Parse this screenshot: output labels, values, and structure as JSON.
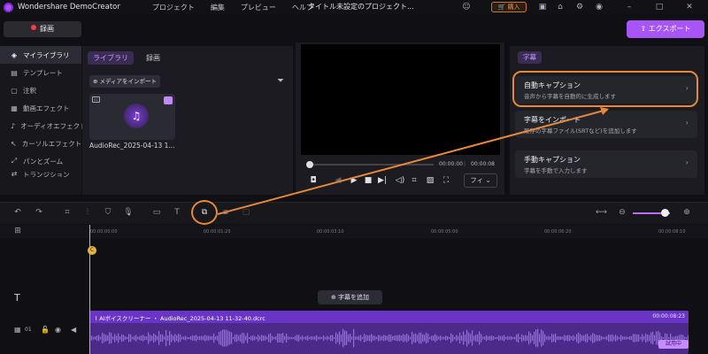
{
  "app": {
    "name": "Wondershare DemoCreator",
    "doc_title": "タイトル未設定のプロジェクト...",
    "menu": [
      "プロジェクト",
      "編集",
      "プレビュー",
      "ヘルプ"
    ],
    "buy_label": "購入"
  },
  "toolbar": {
    "record_label": "録画",
    "export_label": "エクスポート"
  },
  "sidebar": {
    "items": [
      {
        "label": "マイライブラリ",
        "icon": "layers-icon"
      },
      {
        "label": "テンプレート",
        "icon": "template-icon"
      },
      {
        "label": "注釈",
        "icon": "annotation-icon"
      },
      {
        "label": "動画エフェクト",
        "icon": "video-effect-icon"
      },
      {
        "label": "オーディオエフェクト",
        "icon": "audio-effect-icon"
      },
      {
        "label": "カーソルエフェクト",
        "icon": "cursor-effect-icon"
      },
      {
        "label": "パンとズーム",
        "icon": "pan-zoom-icon"
      },
      {
        "label": "トランジション",
        "icon": "transition-icon"
      }
    ]
  },
  "media": {
    "tabs": [
      "ライブラリ",
      "録画"
    ],
    "import_label": "メディアをインポート",
    "clip_name": "AudioRec_2025-04-13 1..."
  },
  "preview": {
    "time_current": "00:00:00",
    "time_total": "00:00:08",
    "fit_label": "フィ"
  },
  "captions": {
    "tab": "字幕",
    "cards": [
      {
        "title": "自動キャプション",
        "desc": "音声から字幕を自動的に生成します"
      },
      {
        "title": "字幕をインポート",
        "desc": "既存の字幕ファイル(SRTなど)を追加します"
      },
      {
        "title": "手動キャプション",
        "desc": "字幕を手動で入力します"
      }
    ]
  },
  "timeline": {
    "ruler": [
      "00:00:00:00",
      "00:00:01:20",
      "00:00:03:10",
      "00:00:05:00",
      "00:00:06:20",
      "00:00:08:10"
    ],
    "add_subtitle": "字幕を追加",
    "track_no": "01",
    "clip_label": "AIボイスクリーナー ・ AudioRec_2025-04-13 11-32-40.dcrc",
    "clip_time": "00:00:08:23",
    "trial_badge": "試用中"
  },
  "colors": {
    "accent": "#a855f7",
    "highlight": "#e7883b"
  }
}
